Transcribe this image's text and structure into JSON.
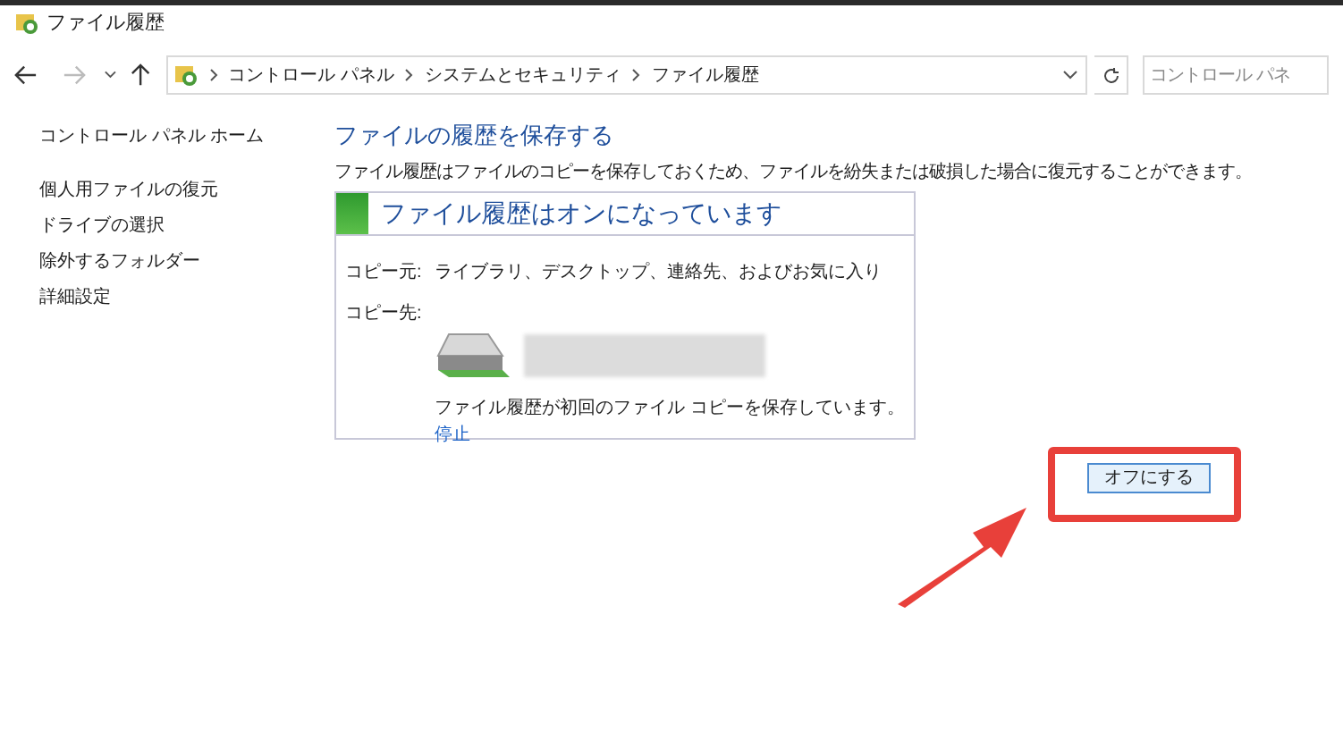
{
  "window": {
    "title": "ファイル履歴"
  },
  "address_bar": {
    "breadcrumbs": [
      "コントロール パネル",
      "システムとセキュリティ",
      "ファイル履歴"
    ]
  },
  "search": {
    "placeholder": "コントロール パネ"
  },
  "sidebar": {
    "home": "コントロール パネル ホーム",
    "items": [
      {
        "label": "個人用ファイルの復元"
      },
      {
        "label": "ドライブの選択"
      },
      {
        "label": "除外するフォルダー"
      },
      {
        "label": "詳細設定"
      }
    ]
  },
  "main": {
    "heading": "ファイルの履歴を保存する",
    "description": "ファイル履歴はファイルのコピーを保存しておくため、ファイルを紛失または破損した場合に復元することができます。",
    "status_panel": {
      "title": "ファイル履歴はオンになっています",
      "on": true,
      "rows": [
        {
          "label": "コピー元:",
          "value": "ライブラリ、デスクトップ、連絡先、およびお気に入り"
        },
        {
          "label": "コピー先:"
        }
      ],
      "progress_text": "ファイル履歴が初回のファイル コピーを保存しています。",
      "stop_link": "停止"
    },
    "button": "オフにする"
  }
}
